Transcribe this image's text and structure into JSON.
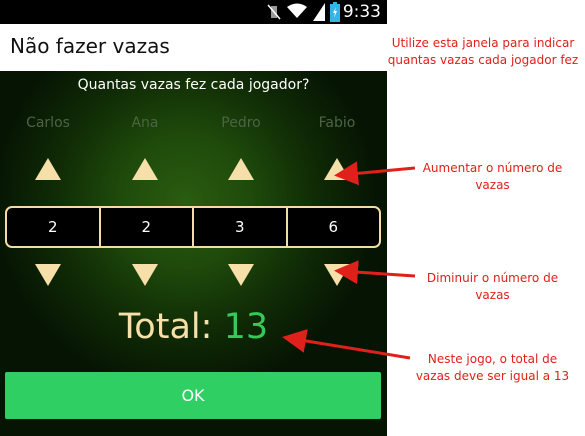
{
  "status_bar": {
    "time": "9:33",
    "icons": [
      "vibrate-icon",
      "wifi-icon",
      "battery-icon"
    ]
  },
  "app_bar": {
    "title": "Não fazer vazas"
  },
  "game": {
    "question": "Quantas vazas fez cada jogador?",
    "players": [
      {
        "name": "Carlos",
        "count": "2"
      },
      {
        "name": "Ana",
        "count": "2"
      },
      {
        "name": "Pedro",
        "count": "3"
      },
      {
        "name": "Fabio",
        "count": "6"
      }
    ],
    "total_label": "Total:",
    "total_value": "13",
    "ok_label": "OK"
  },
  "annotations": {
    "top_right": "Utilize esta janela para indicar quantas vazas cada jogador fez",
    "increase": "Aumentar o número de vazas",
    "decrease": "Diminuir o número de vazas",
    "total_note": "Neste jogo, o total de vazas deve ser igual a 13"
  },
  "colors": {
    "accent_green": "#2fcf63",
    "arrow_cream": "#f6dfa9",
    "annotation_red": "#e0201a"
  }
}
